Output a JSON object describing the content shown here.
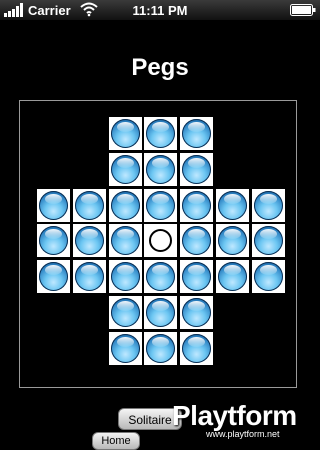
{
  "status_bar": {
    "carrier": "Carrier",
    "time": "11:11 PM",
    "icons": [
      "signal-bars-icon",
      "wifi-icon",
      "battery-icon"
    ]
  },
  "app": {
    "title": "Pegs"
  },
  "board": {
    "layout": "english-cross",
    "empty_cell": "center",
    "peg_count": 32,
    "colors": {
      "cell": "#ffffff",
      "peg": "#4aa8e0",
      "board_border": "#9a9a9a"
    }
  },
  "buttons": {
    "solitaire": "Solitaire",
    "home": "Home"
  },
  "watermark": {
    "brand": "Playtform",
    "url": "www.playtform.net"
  }
}
